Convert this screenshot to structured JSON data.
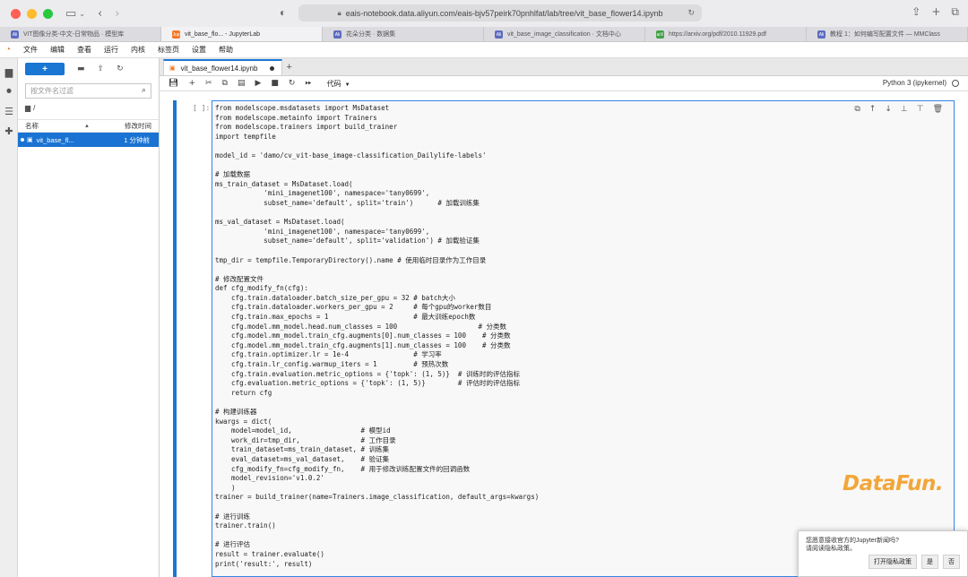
{
  "browser": {
    "url": "eais-notebook.data.aliyun.com/eais-bjv57peirk70pnhlfat/lab/tree/vit_base_flower14.ipynb",
    "tabs": [
      {
        "favicon": "Ali",
        "favicon_color": "#5c6bc0",
        "label": "ViT图像分类-中文-日常物品 · 模型库",
        "active": false
      },
      {
        "favicon": "Jup",
        "favicon_color": "#f37726",
        "label": "vit_base_flo... - JupyterLab",
        "active": true
      },
      {
        "favicon": "Ali",
        "favicon_color": "#5c6bc0",
        "label": "花朵分类 · 数据集",
        "active": false
      },
      {
        "favicon": "Ali",
        "favicon_color": "#5c6bc0",
        "label": "vit_base_image_classification · 文档中心",
        "active": false
      },
      {
        "favicon": "arX",
        "favicon_color": "#43a047",
        "label": "https://arxiv.org/pdf/2010.11929.pdf",
        "active": false
      },
      {
        "favicon": "Ali",
        "favicon_color": "#5c6bc0",
        "label": "教程 1：如何编写配置文件 — MMClass",
        "active": false
      }
    ]
  },
  "menu": [
    "文件",
    "编辑",
    "查看",
    "运行",
    "内核",
    "标签页",
    "设置",
    "帮助"
  ],
  "filebrowser": {
    "new_label": "+",
    "search_placeholder": "按文件名过滤",
    "breadcrumb": "/",
    "col_name": "名称",
    "col_modified": "修改时间",
    "files": [
      {
        "name": "vit_base_fl...",
        "modified": "1 分钟前"
      }
    ]
  },
  "notebook": {
    "tab_title": "vit_base_flower14.ipynb",
    "cell_type": "代码",
    "kernel": "Python 3 (ipykernel)",
    "prompt": "[ ]:",
    "code": "from modelscope.msdatasets import MsDataset\nfrom modelscope.metainfo import Trainers\nfrom modelscope.trainers import build_trainer\nimport tempfile\n\nmodel_id = 'damo/cv_vit-base_image-classification_Dailylife-labels'\n\n# 加载数据\nms_train_dataset = MsDataset.load(\n            'mini_imagenet100', namespace='tany0699',\n            subset_name='default', split='train')      # 加载训练集\n\nms_val_dataset = MsDataset.load(\n            'mini_imagenet100', namespace='tany0699',\n            subset_name='default', split='validation') # 加载验证集\n\ntmp_dir = tempfile.TemporaryDirectory().name # 使用临时目录作为工作目录\n\n# 修改配置文件\ndef cfg_modify_fn(cfg):\n    cfg.train.dataloader.batch_size_per_gpu = 32 # batch大小\n    cfg.train.dataloader.workers_per_gpu = 2     # 每个gpu的worker数目\n    cfg.train.max_epochs = 1                     # 最大训练epoch数\n    cfg.model.mm_model.head.num_classes = 100                    # 分类数\n    cfg.model.mm_model.train_cfg.augments[0].num_classes = 100    # 分类数\n    cfg.model.mm_model.train_cfg.augments[1].num_classes = 100    # 分类数\n    cfg.train.optimizer.lr = 1e-4                # 学习率\n    cfg.train.lr_config.warmup_iters = 1         # 预热次数\n    cfg.train.evaluation.metric_options = {'topk': (1, 5)}  # 训练时的评估指标\n    cfg.evaluation.metric_options = {'topk': (1, 5)}        # 评估时的评估指标\n    return cfg\n\n# 构建训练器\nkwargs = dict(\n    model=model_id,                 # 模型id\n    work_dir=tmp_dir,               # 工作目录\n    train_dataset=ms_train_dataset, # 训练集\n    eval_dataset=ms_val_dataset,    # 验证集\n    cfg_modify_fn=cfg_modify_fn,    # 用于修改训练配置文件的回调函数\n    model_revision='v1.0.2'\n    )\ntrainer = build_trainer(name=Trainers.image_classification, default_args=kwargs)\n\n# 进行训练\ntrainer.train()\n\n# 进行评估\nresult = trainer.evaluate()\nprint('result:', result)"
  },
  "watermark": "DataFun.",
  "notification": {
    "line1": "您愿意接收官方的Jupyter新闻吗?",
    "line2": "请阅读隐私政策。",
    "btn_privacy": "打开隐私政策",
    "btn_yes": "是",
    "btn_no": "否"
  },
  "colors": {
    "accent": "#1976d2",
    "jupyter_orange": "#f37726",
    "watermark": "#f2a63a"
  }
}
